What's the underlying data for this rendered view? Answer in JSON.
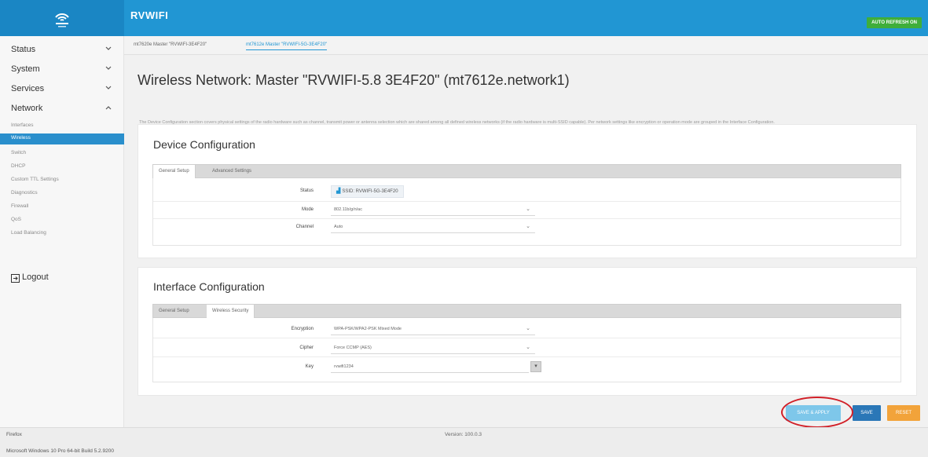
{
  "app": {
    "title": "RVWIFI",
    "auto_refresh_label": "AUTO REFRESH ON",
    "brand_color": "#2196d3"
  },
  "sidebar": {
    "items": [
      {
        "label": "Status",
        "expanded": false
      },
      {
        "label": "System",
        "expanded": false
      },
      {
        "label": "Services",
        "expanded": false
      },
      {
        "label": "Network",
        "expanded": true
      }
    ],
    "network_subitems": [
      {
        "label": "Interfaces",
        "active": false
      },
      {
        "label": "Wireless",
        "active": true
      },
      {
        "label": "Switch",
        "active": false
      },
      {
        "label": "DHCP",
        "active": false
      },
      {
        "label": "Custom TTL Settings",
        "active": false
      },
      {
        "label": "Diagnostics",
        "active": false
      },
      {
        "label": "Firewall",
        "active": false
      },
      {
        "label": "QoS",
        "active": false
      },
      {
        "label": "Load Balancing",
        "active": false
      }
    ],
    "logout_label": "Logout"
  },
  "tabs": [
    {
      "label": "mt7620e Master \"RVWIFI-3E4F20\"",
      "active": false
    },
    {
      "label": "mt7612e Master \"RVWIFI-5G-3E4F20\"",
      "active": true
    }
  ],
  "page": {
    "title": "Wireless Network: Master \"RVWIFI-5.8 3E4F20\" (mt7612e.network1)",
    "description": "The Device Configuration section covers physical settings of the radio hardware such as channel, transmit power or antenna selection which are shared among all defined wireless networks (if the radio hardware is multi-SSID capable). Per network settings like encryption or operation mode are grouped in the Interface Configuration."
  },
  "device_config": {
    "heading": "Device Configuration",
    "tabs": [
      "General Setup",
      "Advanced Settings"
    ],
    "status_label": "Status",
    "status_value": "SSID: RVWIFI-5G-3E4F20",
    "mode_label": "Mode",
    "mode_value": "802.11b/g/n/ac",
    "channel_label": "Channel",
    "channel_value": "Auto"
  },
  "interface_config": {
    "heading": "Interface Configuration",
    "tabs": [
      "General Setup",
      "Wireless Security"
    ],
    "encryption_label": "Encryption",
    "encryption_value": "WPA-PSK/WPA2-PSK Mixed Mode",
    "cipher_label": "Cipher",
    "cipher_value": "Force CCMP (AES)",
    "key_label": "Key",
    "key_value": "rvwifi1234"
  },
  "actions": {
    "save_apply_label": "SAVE & APPLY",
    "save_label": "SAVE",
    "reset_label": "RESET"
  },
  "footer": {
    "browser": "Firefox",
    "version": "Version: 100.0.3",
    "os": "Microsoft Windows 10 Pro 64-bit Build 5.2.9200"
  }
}
